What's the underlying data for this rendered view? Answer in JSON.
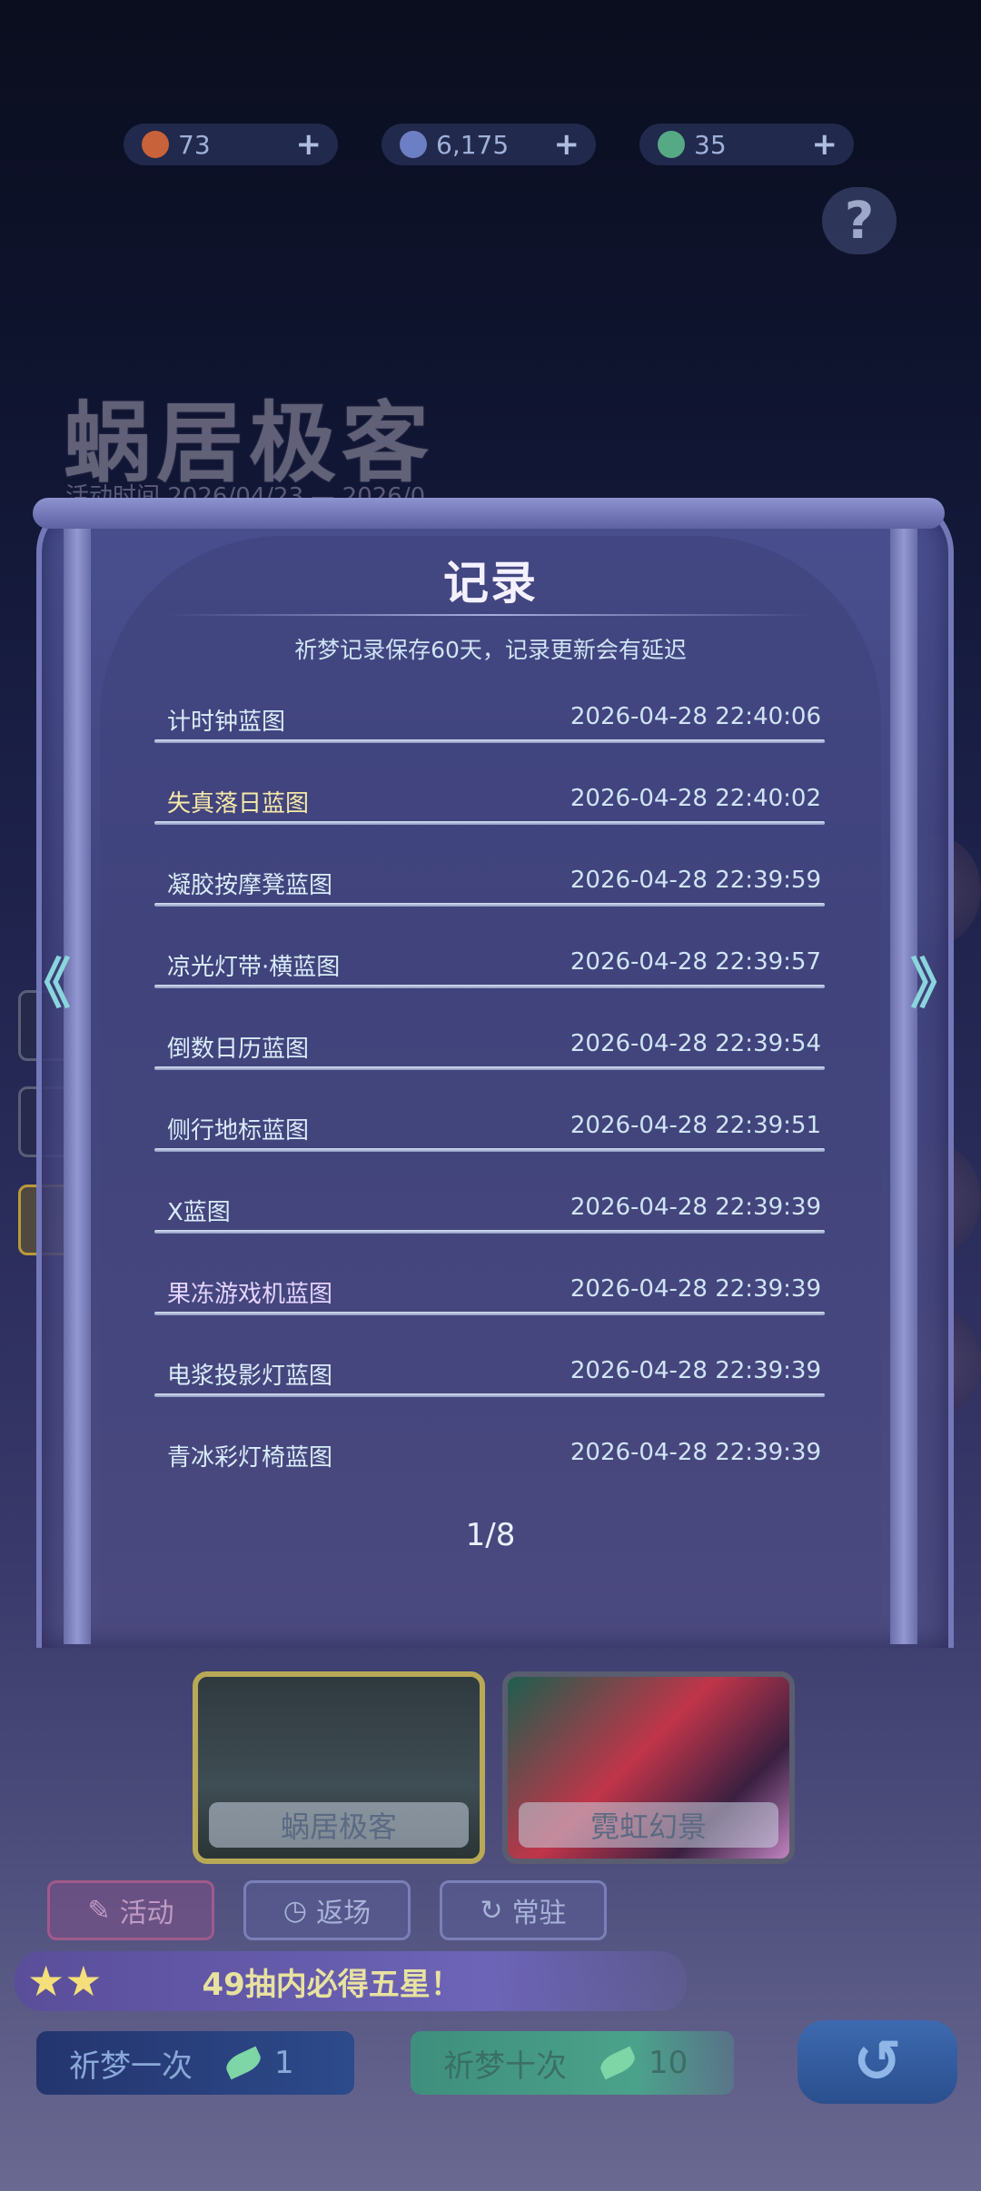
{
  "currency": [
    {
      "icon": "sun-gem-icon",
      "value": "73",
      "color": "#e07a4a"
    },
    {
      "icon": "moon-orb-icon",
      "value": "6,175",
      "color": "#7d90d6"
    },
    {
      "icon": "leaf-ticket-icon",
      "value": "35",
      "color": "#6cc49a"
    }
  ],
  "help_label": "?",
  "background": {
    "banner_title": "蜗居极客",
    "event_time": "活动时间 2026/04/23 — 2026/0..."
  },
  "modal": {
    "title": "记录",
    "subtitle": "祈梦记录保存60天，记录更新会有延迟",
    "records": [
      {
        "name": "计时钟蓝图",
        "time": "2026-04-28 22:40:06",
        "tier": "normal"
      },
      {
        "name": "失真落日蓝图",
        "time": "2026-04-28 22:40:02",
        "tier": "gold"
      },
      {
        "name": "凝胶按摩凳蓝图",
        "time": "2026-04-28 22:39:59",
        "tier": "normal"
      },
      {
        "name": "凉光灯带·横蓝图",
        "time": "2026-04-28 22:39:57",
        "tier": "normal"
      },
      {
        "name": "倒数日历蓝图",
        "time": "2026-04-28 22:39:54",
        "tier": "normal"
      },
      {
        "name": "侧行地标蓝图",
        "time": "2026-04-28 22:39:51",
        "tier": "normal"
      },
      {
        "name": "X蓝图",
        "time": "2026-04-28 22:39:39",
        "tier": "normal"
      },
      {
        "name": "果冻游戏机蓝图",
        "time": "2026-04-28 22:39:39",
        "tier": "purple"
      },
      {
        "name": "电浆投影灯蓝图",
        "time": "2026-04-28 22:39:39",
        "tier": "normal"
      },
      {
        "name": "青冰彩灯椅蓝图",
        "time": "2026-04-28 22:39:39",
        "tier": "normal"
      }
    ],
    "pager": "1/8",
    "prev_arrow": "《",
    "next_arrow": "》"
  },
  "banners": [
    {
      "label": "蜗居极客",
      "selected": true
    },
    {
      "label": "霓虹幻景",
      "selected": false
    }
  ],
  "tabs": [
    {
      "label": "活动"
    },
    {
      "label": "返场"
    },
    {
      "label": "常驻"
    }
  ],
  "guarantee_text": "49抽内必得五星！",
  "wish_once": {
    "label": "祈梦一次",
    "cost": "1"
  },
  "wish_ten": {
    "label": "祈梦十次",
    "cost": "10"
  },
  "back_label": "↺"
}
